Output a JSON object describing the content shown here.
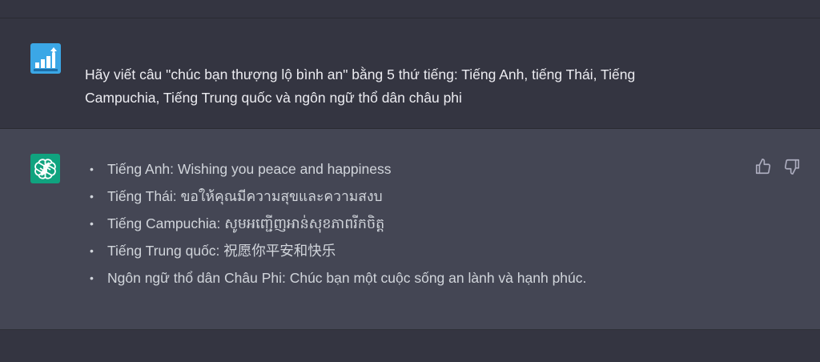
{
  "conversation": {
    "user_message": {
      "lines": [
        "Hãy viết câu \"chúc bạn thượng lộ bình an\" bằng 5 thứ tiếng: Tiếng Anh, tiếng Thái, Tiếng",
        "Campuchia, Tiếng Trung quốc và ngôn ngữ thổ dân châu phi"
      ],
      "avatar_icon": "bar-chart-logo",
      "avatar_color": "#3ba7e6"
    },
    "assistant_message": {
      "avatar_icon": "openai-logo",
      "avatar_color": "#10a37f",
      "bullet": "•",
      "items": [
        "Tiếng Anh: Wishing you peace and happiness",
        "Tiếng Thái: ขอให้คุณมีความสุขและความสงบ",
        "Tiếng Campuchia: សូមអញ្ជើញអាន់សុខភាពរីកចិត្ត",
        "Tiếng Trung quốc: 祝愿你平安和快乐",
        "Ngôn ngữ thổ dân Châu Phi: Chúc bạn một cuộc sống an lành và hạnh phúc."
      ],
      "feedback_icons": [
        "thumbs-up-icon",
        "thumbs-down-icon"
      ]
    }
  },
  "colors": {
    "background": "#343541",
    "assistant_background": "#444654",
    "text": "#ececf1"
  }
}
